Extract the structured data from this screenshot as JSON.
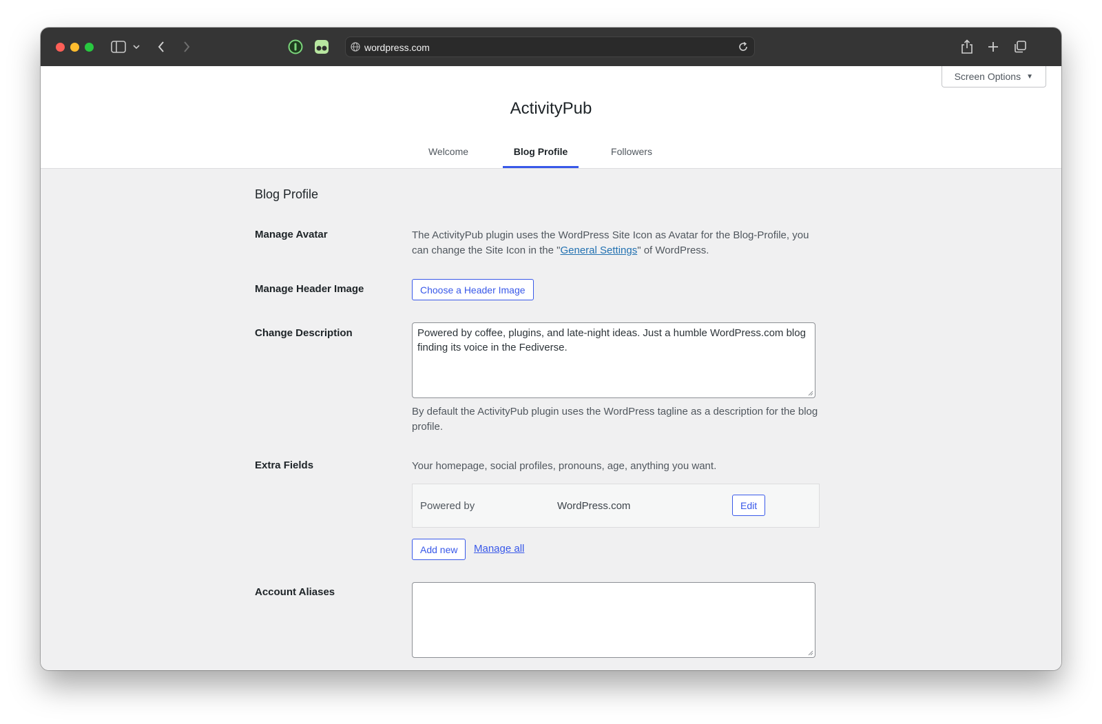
{
  "browser": {
    "url": "wordpress.com"
  },
  "screen_options": {
    "label": "Screen Options",
    "arrow": "▼"
  },
  "page": {
    "title": "ActivityPub",
    "tabs": [
      {
        "label": "Welcome",
        "active": false
      },
      {
        "label": "Blog Profile",
        "active": true
      },
      {
        "label": "Followers",
        "active": false
      }
    ]
  },
  "section": {
    "title": "Blog Profile",
    "avatar": {
      "label": "Manage Avatar",
      "text_before": "The ActivityPub plugin uses the WordPress Site Icon as Avatar for the Blog-Profile, you can change the Site Icon in the \"",
      "link": "General Settings",
      "text_after": "\" of WordPress."
    },
    "header_image": {
      "label": "Manage Header Image",
      "button": "Choose a Header Image"
    },
    "description": {
      "label": "Change Description",
      "value": "Powered by coffee, plugins, and late-night ideas. Just a humble WordPress.com blog finding its voice in the Fediverse.",
      "help": "By default the ActivityPub plugin uses the WordPress tagline as a description for the blog profile."
    },
    "extra_fields": {
      "label": "Extra Fields",
      "help": "Your homepage, social profiles, pronouns, age, anything you want.",
      "fields": [
        {
          "name": "Powered by",
          "value": "WordPress.com",
          "edit_label": "Edit"
        }
      ],
      "add_new": "Add new",
      "manage_all": "Manage all"
    },
    "aliases": {
      "label": "Account Aliases",
      "value": ""
    }
  },
  "colors": {
    "accent": "#3858e9",
    "link": "#2271b1",
    "toolbar": "#353535"
  }
}
